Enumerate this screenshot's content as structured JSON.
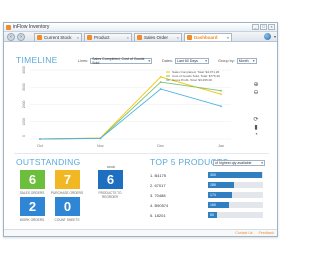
{
  "window": {
    "title": "inFlow Inventory",
    "controls": [
      "_",
      "□",
      "×"
    ]
  },
  "tabs": [
    {
      "label": "Current Stock",
      "active": false
    },
    {
      "label": "Product",
      "active": false
    },
    {
      "label": "Sales Order",
      "active": false
    },
    {
      "label": "Dashboard",
      "active": true
    }
  ],
  "timeline": {
    "title": "TIMELINE",
    "lines_label": "Lines:",
    "lines_value": "Sales Completed, Cost of Goods Sold",
    "dates_label": "Dates:",
    "dates_value": "Last 60 Days",
    "group_label": "Group by:",
    "group_value": "Month"
  },
  "chart_data": {
    "type": "line",
    "categories": [
      "Oct",
      "Nov",
      "Dec",
      "Jan"
    ],
    "ylim": [
      0,
      4000
    ],
    "yticks": [
      "4000",
      "3000",
      "2000",
      "1000",
      "0"
    ],
    "series": [
      {
        "name": "Sales Completed, Total: $4,071.26",
        "color": "#f2c511",
        "values": [
          0,
          60,
          3600,
          2600
        ]
      },
      {
        "name": "Cost of Goods Sold, Total: $776.26",
        "color": "#7cc36a",
        "values": [
          0,
          40,
          3300,
          2800
        ]
      },
      {
        "name": "Gross Profit, Total: $3,295.00",
        "color": "#4fb1e6",
        "values": [
          0,
          30,
          2900,
          1900
        ]
      }
    ]
  },
  "outstanding": {
    "title": "OUTSTANDING",
    "stock_label": "stock",
    "tiles": [
      {
        "value": "6",
        "caption": "SALES ORDERS",
        "color": "#6cbf3c"
      },
      {
        "value": "7",
        "caption": "PURCHASE ORDERS",
        "color": "#f2b824"
      },
      {
        "value": "6",
        "caption": "PRODUCTS TO REORDER",
        "color": "#1f6fc1"
      },
      {
        "value": "2",
        "caption": "WORK ORDERS",
        "color": "#2f86d4"
      },
      {
        "value": "0",
        "caption": "COUNT SHEETS",
        "color": "#2f86d4"
      }
    ]
  },
  "top_products": {
    "title": "TOP 5 PRODUCTS",
    "by_label": "of highest qty available",
    "items": [
      {
        "name": "1. B4175",
        "value": "300",
        "fraction": 0.98
      },
      {
        "name": "2. 67017",
        "value": "285",
        "fraction": 0.48
      },
      {
        "name": "3. 70488",
        "value": "174",
        "fraction": 0.44
      },
      {
        "name": "4. B90574",
        "value": "160",
        "fraction": 0.38
      },
      {
        "name": "5. 18201",
        "value": "50",
        "fraction": 0.16
      }
    ]
  },
  "status": {
    "link1": "Contact Us",
    "link2": "Feedback"
  }
}
